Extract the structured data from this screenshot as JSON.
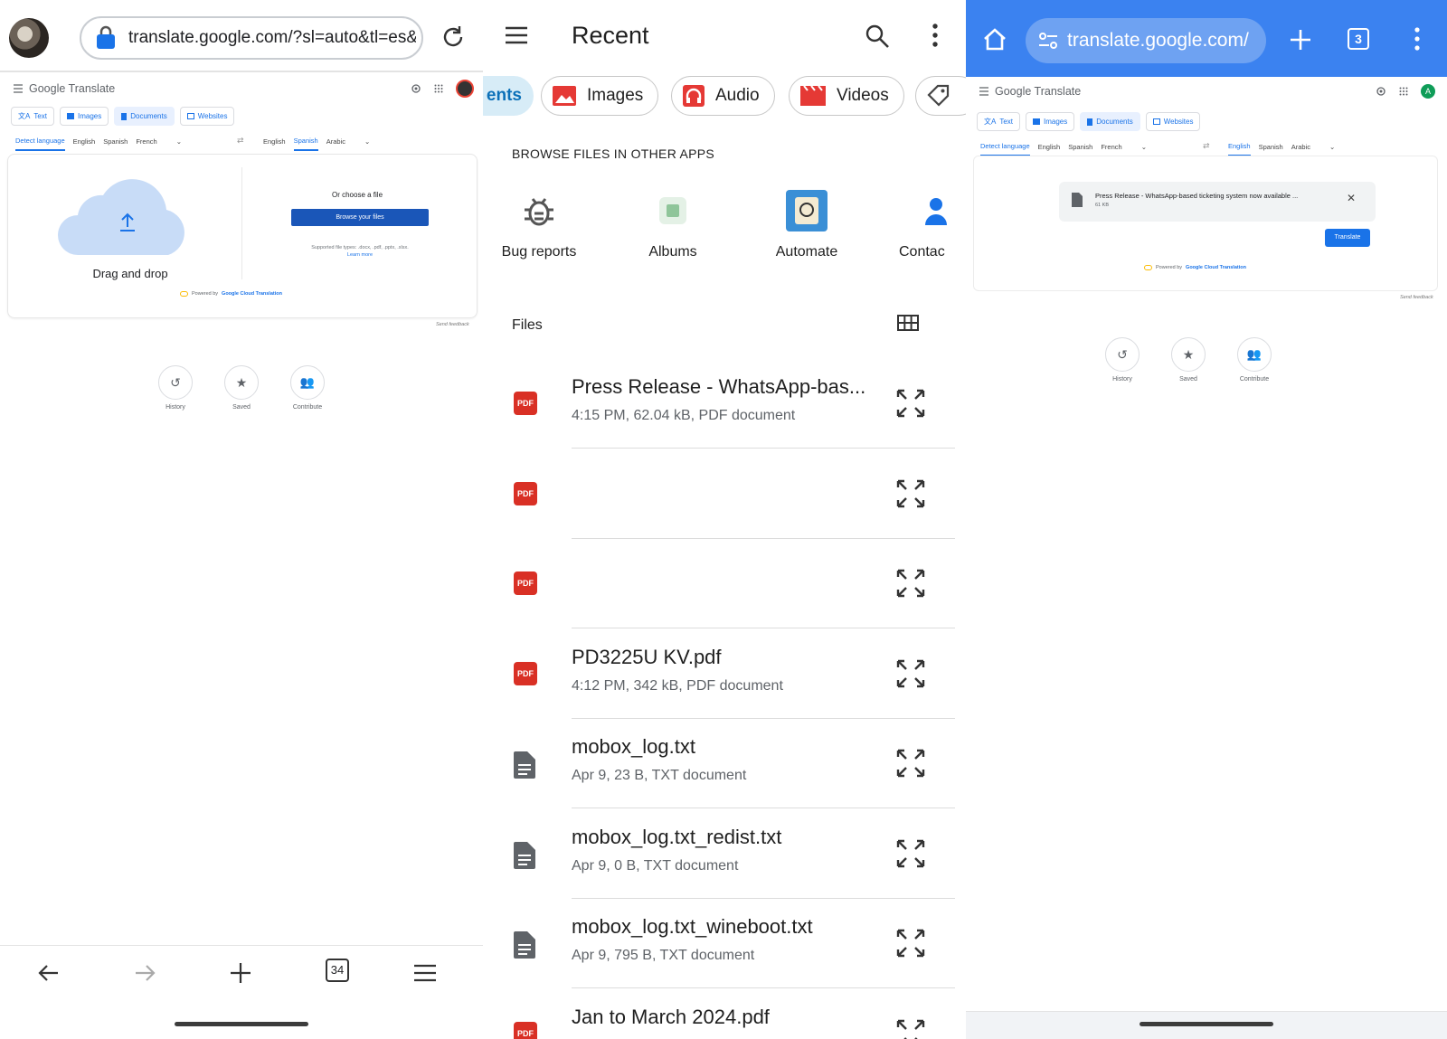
{
  "panel1": {
    "url": "translate.google.com/?sl=auto&tl=es&",
    "app_name": "Google Translate",
    "tabs": [
      "Text",
      "Images",
      "Documents",
      "Websites"
    ],
    "source_langs": [
      "Detect language",
      "English",
      "Spanish",
      "French"
    ],
    "target_langs": [
      "English",
      "Spanish",
      "Arabic"
    ],
    "drag_drop": "Drag and drop",
    "choose_file": "Or choose a file",
    "browse_button": "Browse your files",
    "supported": "Supported file types: .docx, .pdf, .pptx, .xlsx.",
    "learn_more": "Learn more",
    "powered_by": "Powered by",
    "powered_by_brand": "Google Cloud Translation",
    "send_feedback": "Send feedback",
    "bottom_items": [
      "History",
      "Saved",
      "Contribute"
    ],
    "tab_count": "34"
  },
  "panel2": {
    "title": "Recent",
    "chips": [
      "ents",
      "Images",
      "Audio",
      "Videos"
    ],
    "browse_header": "BROWSE FILES IN OTHER APPS",
    "apps": [
      "Bug reports",
      "Albums",
      "Automate",
      "Contac"
    ],
    "files_header": "Files",
    "files": [
      {
        "name": "Press Release - WhatsApp-bas...",
        "meta": "4:15 PM, 62.04 kB, PDF document",
        "type": "pdf"
      },
      {
        "name": "",
        "meta": "",
        "type": "pdf"
      },
      {
        "name": "",
        "meta": "",
        "type": "pdf"
      },
      {
        "name": "PD3225U KV.pdf",
        "meta": "4:12 PM, 342 kB, PDF document",
        "type": "pdf"
      },
      {
        "name": "mobox_log.txt",
        "meta": "Apr 9, 23 B, TXT document",
        "type": "txt"
      },
      {
        "name": "mobox_log.txt_redist.txt",
        "meta": "Apr 9, 0 B, TXT document",
        "type": "txt"
      },
      {
        "name": "mobox_log.txt_wineboot.txt",
        "meta": "Apr 9, 795 B, TXT document",
        "type": "txt"
      },
      {
        "name": "Jan to March 2024.pdf",
        "meta": "",
        "type": "pdf"
      }
    ],
    "pdf_label": "PDF"
  },
  "panel3": {
    "url": "translate.google.com/",
    "tab_count": "3",
    "app_name": "Google Translate",
    "avatar_letter": "A",
    "tabs": [
      "Text",
      "Images",
      "Documents",
      "Websites"
    ],
    "source_langs": [
      "Detect language",
      "English",
      "Spanish",
      "French"
    ],
    "target_langs": [
      "English",
      "Spanish",
      "Arabic"
    ],
    "file_name": "Press Release - WhatsApp-based ticketing system now available ...",
    "file_size": "61 KB",
    "translate_button": "Translate",
    "powered_by": "Powered by",
    "powered_by_brand": "Google Cloud Translation",
    "send_feedback": "Send feedback",
    "bottom_items": [
      "History",
      "Saved",
      "Contribute"
    ]
  },
  "colors": {
    "accent": "#1a73e8",
    "pdf_red": "#d93025",
    "chrome_blue": "#3b82f0"
  }
}
